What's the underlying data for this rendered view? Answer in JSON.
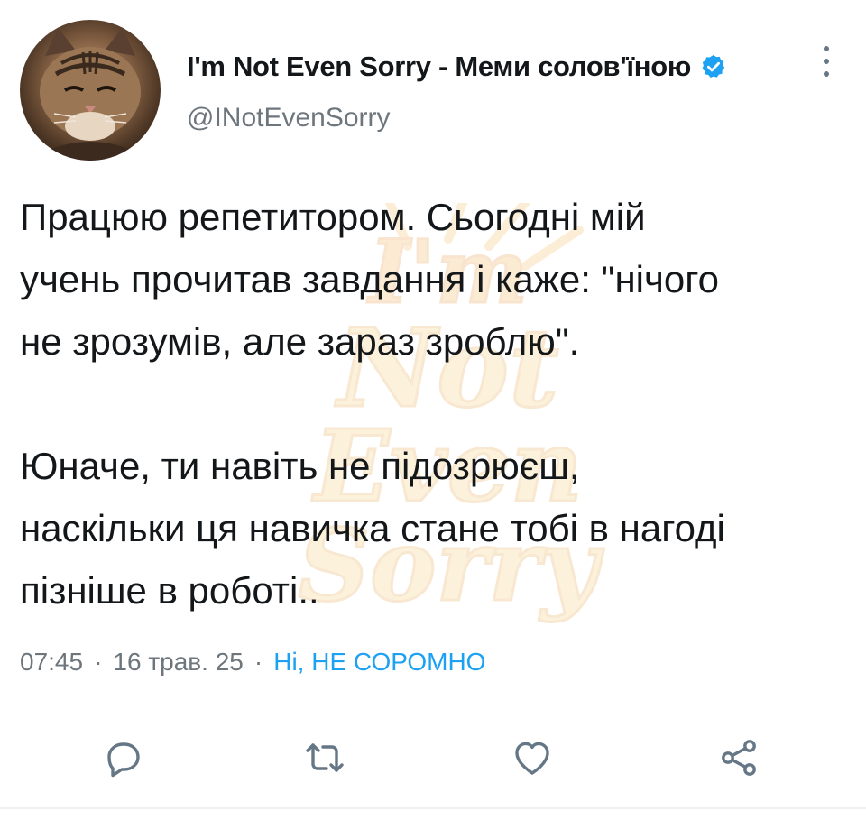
{
  "author": {
    "display_name": "I'm Not Even Sorry - Меми солов'їною",
    "handle": "@INotEvenSorry",
    "verified": true,
    "avatar_icon": "cat-avatar"
  },
  "tweet": {
    "paragraphs": [
      "Працюю репетитором. Сьогодні мій\nучень прочитав завдання і каже: \"нічого\nне зрозумів, але зараз зроблю\".",
      "Юначе, ти навіть не підозрюєш,\nнаскільки ця навичка стане тобі в нагоді\nпізніше в роботі.."
    ],
    "watermark": "I'm Not Even Sorry",
    "time": "07:45",
    "date": "16 трав. 25",
    "separator": "·",
    "source": "Ні, НЕ СОРОМНО"
  },
  "actions": {
    "reply_icon": "reply-icon",
    "retweet_icon": "retweet-icon",
    "like_icon": "heart-icon",
    "share_icon": "share-icon"
  },
  "colors": {
    "accent": "#1da1f2",
    "text": "#14171a",
    "secondary": "#6e767d"
  }
}
